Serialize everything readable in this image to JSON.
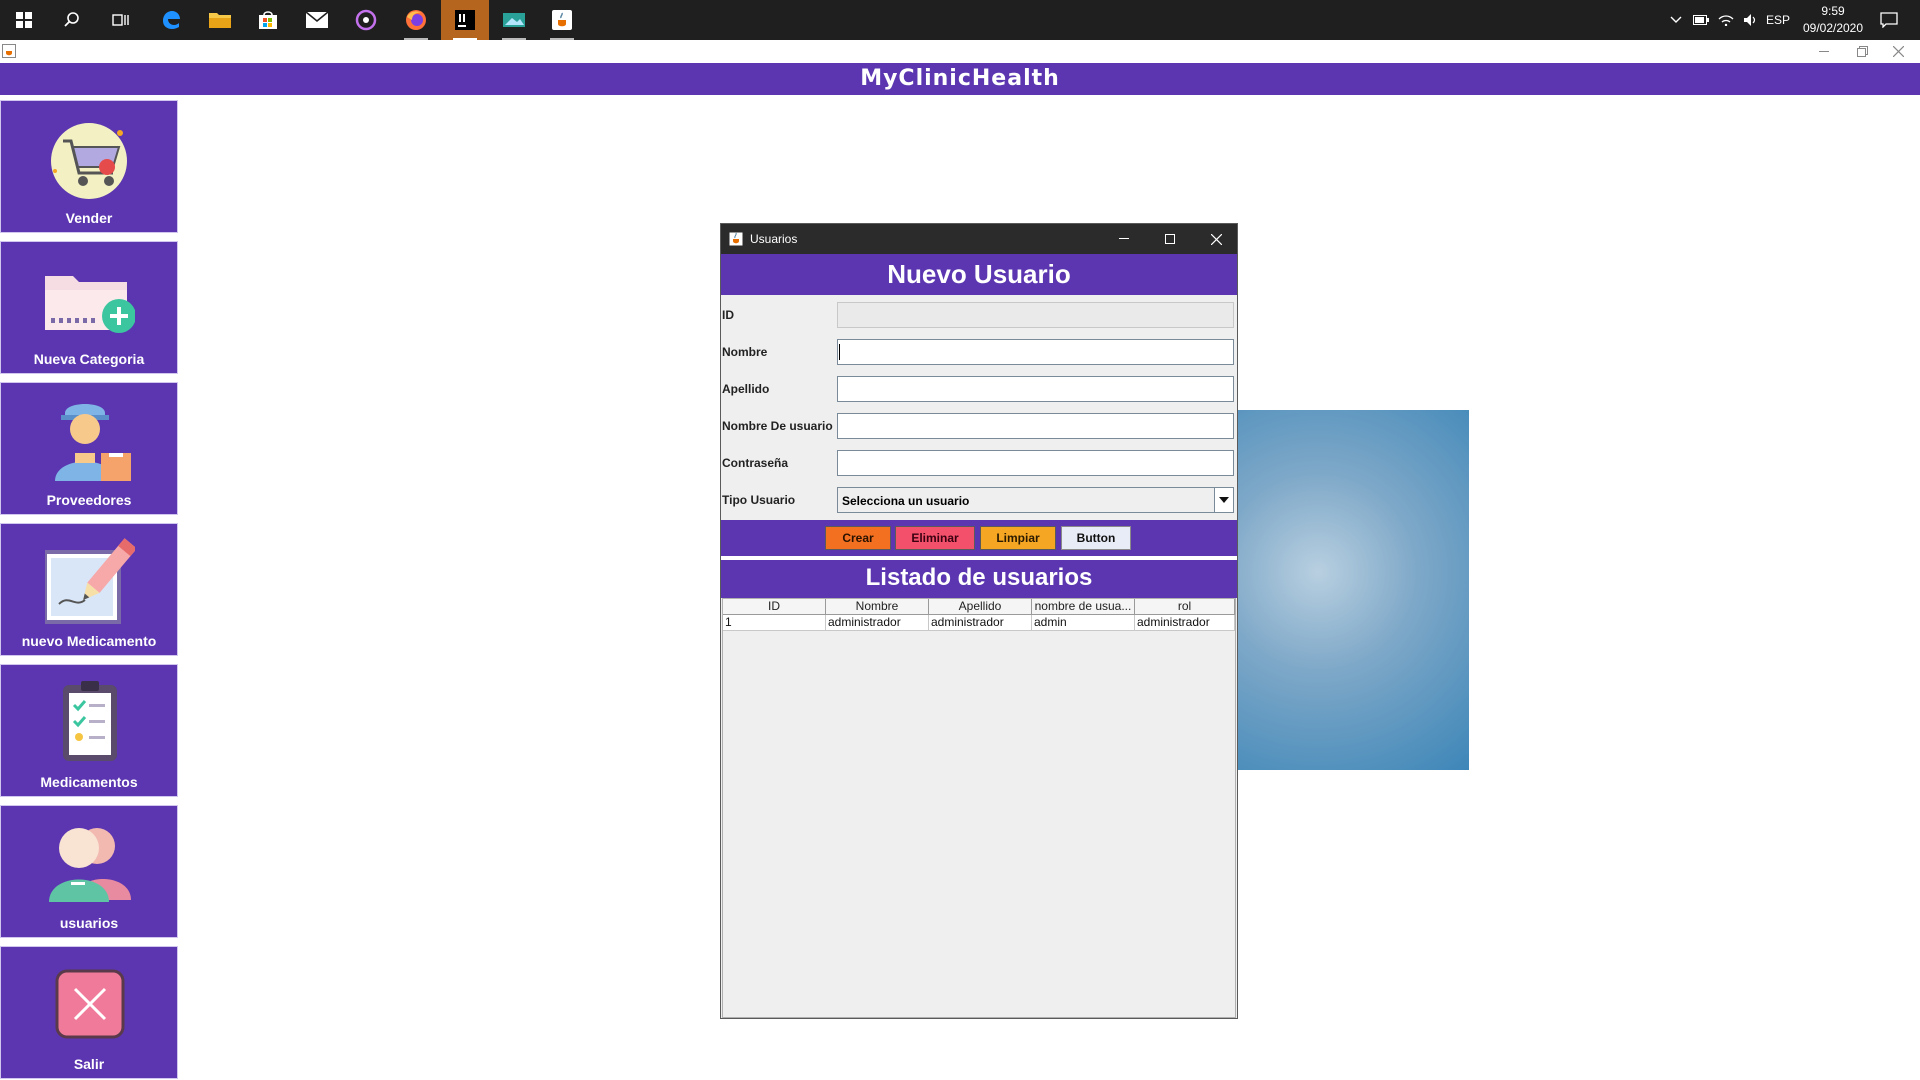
{
  "taskbar": {
    "tray": {
      "language": "ESP",
      "time": "9:59",
      "date": "09/02/2020"
    }
  },
  "app": {
    "brand": "MyClinicHealth",
    "sidebar": {
      "items": [
        {
          "label": "Vender",
          "icon": "shopping-cart-icon"
        },
        {
          "label": "Nueva Categoria",
          "icon": "folder-add-icon"
        },
        {
          "label": "Proveedores",
          "icon": "delivery-person-icon"
        },
        {
          "label": "nuevo Medicamento",
          "icon": "edit-pencil-icon"
        },
        {
          "label": "Medicamentos",
          "icon": "clipboard-checklist-icon"
        },
        {
          "label": "usuarios",
          "icon": "users-icon"
        },
        {
          "label": "Salir",
          "icon": "close-x-icon"
        }
      ]
    }
  },
  "dialog": {
    "title": "Usuarios",
    "header": "Nuevo Usuario",
    "form": {
      "id_label": "ID",
      "nombre_label": "Nombre",
      "apellido_label": "Apellido",
      "usuario_label": "Nombre De usuario",
      "password_label": "Contraseña",
      "tipo_label": "Tipo Usuario",
      "tipo_selected": "Selecciona un usuario"
    },
    "buttons": {
      "crear": "Crear",
      "eliminar": "Eliminar",
      "limpiar": "Limpiar",
      "button": "Button"
    },
    "colors": {
      "crear": "#f37021",
      "eliminar": "#f2506b",
      "limpiar": "#f5a623",
      "button": "#e8ecf7",
      "accent": "#5b36b0"
    },
    "list_header": "Listado de usuarios",
    "table": {
      "columns": [
        "ID",
        "Nombre",
        "Apellido",
        "nombre de usua...",
        "rol"
      ],
      "rows": [
        [
          "1",
          "administrador",
          "administrador",
          "admin",
          "administrador"
        ]
      ]
    }
  }
}
